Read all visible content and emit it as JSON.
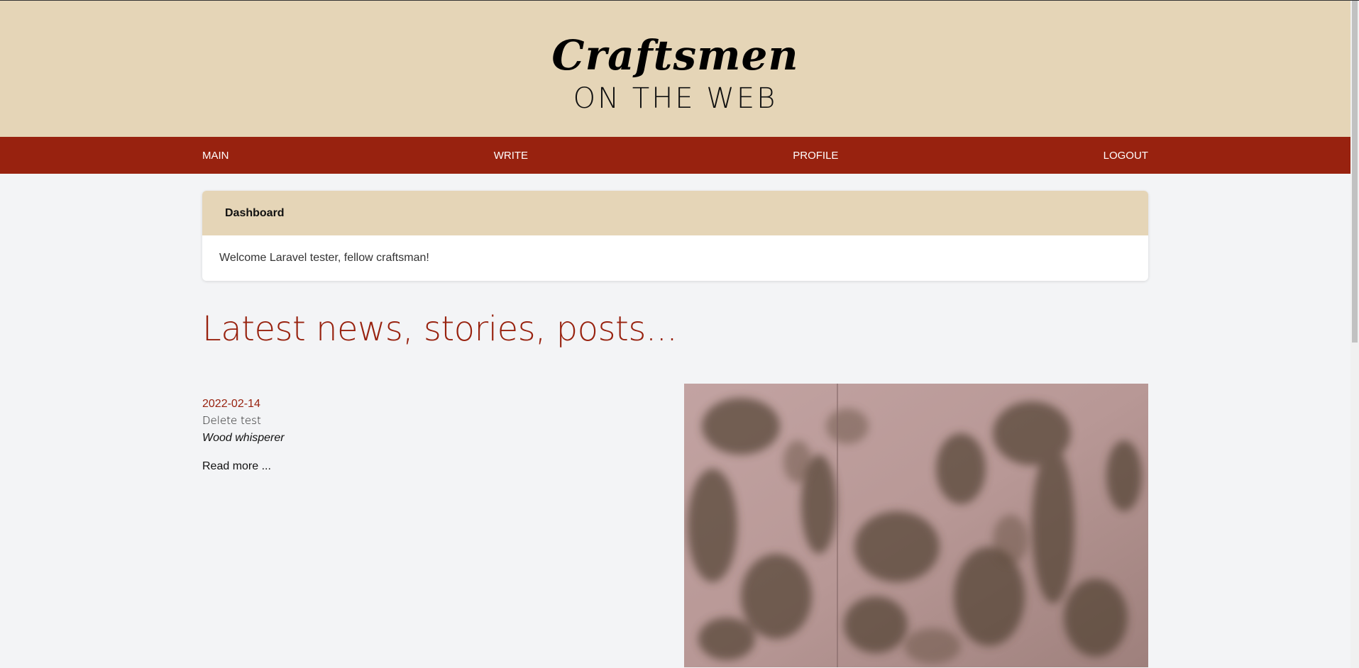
{
  "header": {
    "logo_title": "Craftsmen",
    "logo_subtitle": "ON THE WEB"
  },
  "nav": {
    "items": [
      {
        "label": "MAIN"
      },
      {
        "label": "WRITE"
      },
      {
        "label": "PROFILE"
      },
      {
        "label": "LOGOUT"
      }
    ]
  },
  "dashboard": {
    "title": "Dashboard",
    "welcome": "Welcome Laravel tester, fellow craftsman!"
  },
  "latest": {
    "heading": "Latest news, stories, posts..."
  },
  "post": {
    "date": "2022-02-14",
    "title": "Delete test",
    "author": "Wood whisperer",
    "read_more": "Read more ...",
    "image_icon": "wood-grain-photo"
  },
  "colors": {
    "header_bg": "#e5d5b7",
    "nav_bg": "#98220f",
    "accent": "#98220f",
    "page_bg": "#f3f4f6"
  }
}
